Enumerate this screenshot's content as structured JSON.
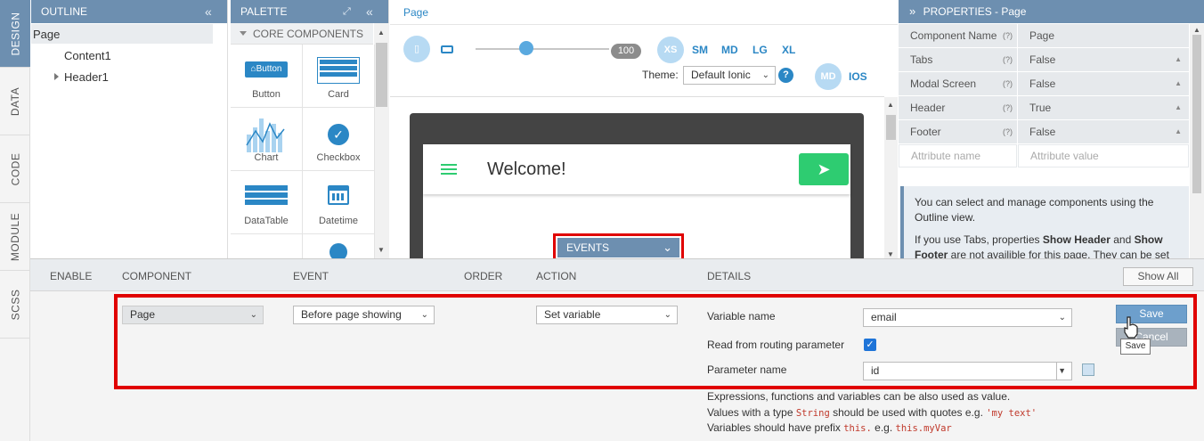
{
  "vtabs": [
    "DESIGN",
    "DATA",
    "CODE",
    "MODULE",
    "SCSS"
  ],
  "outline": {
    "title": "OUTLINE",
    "items": [
      "Page",
      "Content1",
      "Header1"
    ]
  },
  "palette": {
    "title": "PALETTE",
    "section": "CORE COMPONENTS",
    "items": [
      {
        "label": "Button",
        "btn_text": "Button"
      },
      {
        "label": "Card"
      },
      {
        "label": "Chart"
      },
      {
        "label": "Checkbox"
      },
      {
        "label": "DataTable"
      },
      {
        "label": "Datetime"
      }
    ]
  },
  "page": {
    "tab": "Page",
    "zoom": "100",
    "breakpoints": [
      "XS",
      "SM",
      "MD",
      "LG",
      "XL"
    ],
    "theme_label": "Theme:",
    "theme_value": "Default Ionic",
    "platforms": [
      "MD",
      "IOS"
    ],
    "header_title": "Welcome!",
    "events_tab": "EVENTS"
  },
  "properties": {
    "title": "PROPERTIES - Page",
    "rows": [
      {
        "key": "Component Name",
        "value": "Page",
        "help": "(?)"
      },
      {
        "key": "Tabs",
        "value": "False",
        "help": "(?)"
      },
      {
        "key": "Modal Screen",
        "value": "False",
        "help": "(?)"
      },
      {
        "key": "Header",
        "value": "True",
        "help": "(?)"
      },
      {
        "key": "Footer",
        "value": "False",
        "help": "(?)"
      }
    ],
    "attr_name_placeholder": "Attribute name",
    "attr_value_placeholder": "Attribute value",
    "info1": "You can select and manage components using the Outline view.",
    "info2_a": "If you use Tabs, properties ",
    "info2_b": "Show Header",
    "info2_c": " and ",
    "info2_d": "Show Footer",
    "info2_e": " are not availible for this page. They can be set"
  },
  "events": {
    "headers": [
      "ENABLE",
      "COMPONENT",
      "EVENT",
      "ORDER",
      "ACTION",
      "DETAILS"
    ],
    "show_all": "Show All",
    "component": "Page",
    "event": "Before page showing",
    "action": "Set variable",
    "variable_label": "Variable name",
    "variable_value": "email",
    "routing_label": "Read from routing parameter",
    "param_label": "Parameter name",
    "param_value": "id",
    "save": "Save",
    "cancel": "Cancel",
    "tooltip": "Save",
    "note1": "Expressions, functions and variables can be also used as value.",
    "note2_a": "Values with a type ",
    "note2_b": "String",
    "note2_c": " should be used with quotes e.g. ",
    "note2_d": "'my text'",
    "note3_a": "Variables should have prefix ",
    "note3_b": "this.",
    "note3_c": " e.g. ",
    "note3_d": "this.myVar"
  },
  "colors": {
    "panel_header": "#6d8fb0",
    "highlight": "#e00000",
    "green": "#2ecc71",
    "link": "#2b87c5"
  }
}
